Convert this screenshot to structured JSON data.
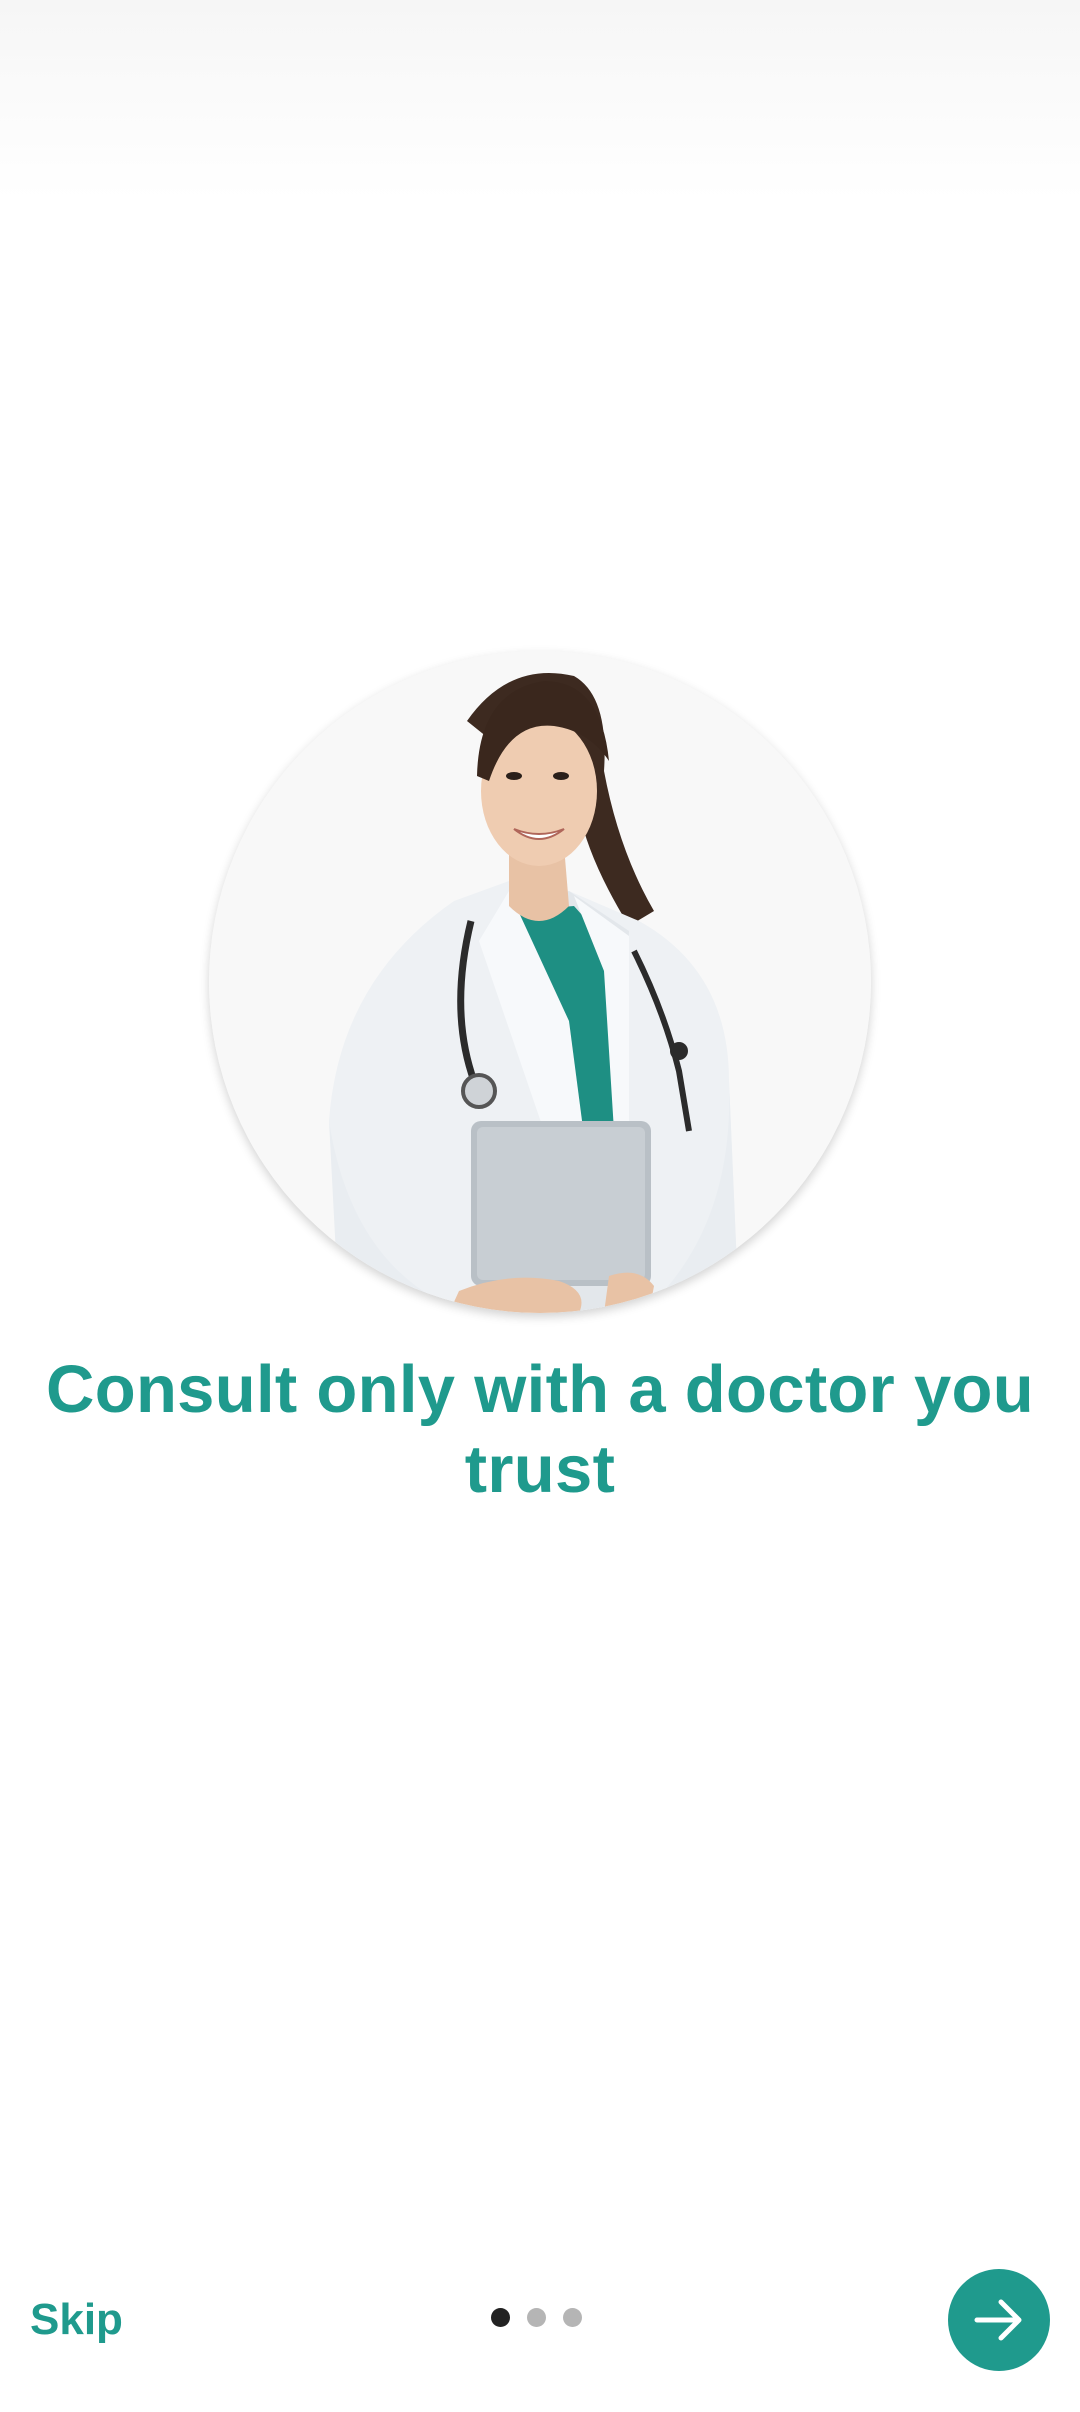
{
  "onboarding": {
    "headline": "Consult only with a doctor you trust",
    "image_subject": "doctor-illustration",
    "accent_color": "#1f9a8d"
  },
  "footer": {
    "skip_label": "Skip",
    "next_icon": "arrow-right-icon",
    "page_count": 3,
    "active_page": 1
  }
}
